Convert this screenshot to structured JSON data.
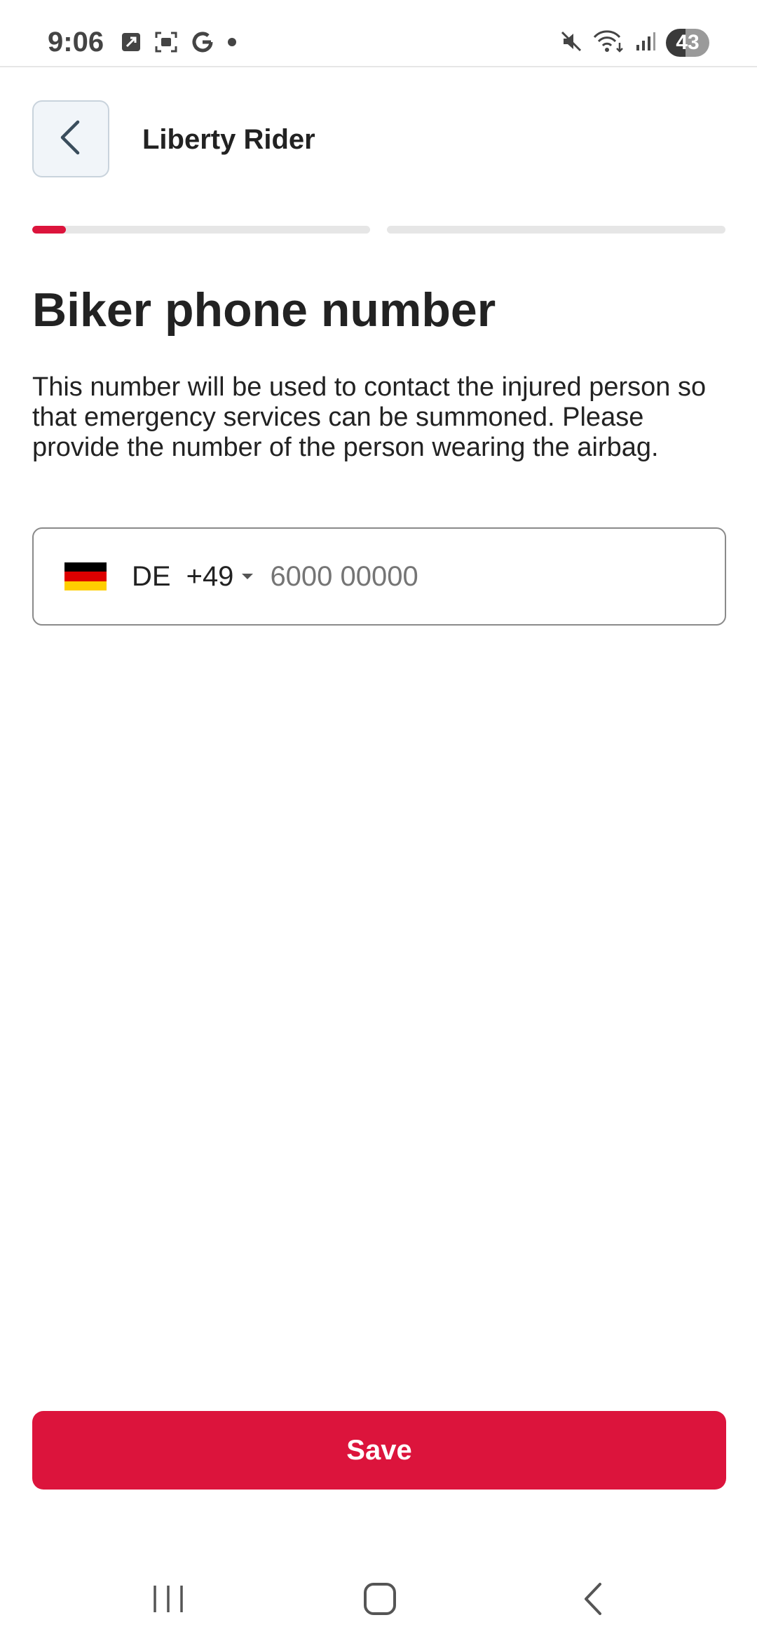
{
  "status_bar": {
    "time": "9:06",
    "left_icons": [
      "phone-call-icon",
      "screenshot-icon",
      "google-icon",
      "dot-icon"
    ],
    "right_icons": [
      "mute-icon",
      "wifi-icon",
      "signal-icon"
    ],
    "battery": "43"
  },
  "header": {
    "back_icon": "chevron-left-icon",
    "title": "Liberty Rider"
  },
  "progress": {
    "steps": 2,
    "current_step": 1,
    "step1_fill": 0.1,
    "step2_fill": 0,
    "accent_color": "#dc143c",
    "track_color": "#e6e6e6"
  },
  "main": {
    "title": "Biker phone number",
    "description": "This number will be used to contact the injured person so that emergency services can be summoned. Please provide the number of the person wearing the airbag."
  },
  "phone_field": {
    "country_flag": "germany-flag-icon",
    "country_code": "DE",
    "dial_code": "+49",
    "value": "",
    "placeholder": "6000 00000"
  },
  "actions": {
    "save_label": "Save"
  },
  "nav_bar": {
    "items": [
      "recent-apps-icon",
      "home-icon",
      "back-icon"
    ]
  }
}
